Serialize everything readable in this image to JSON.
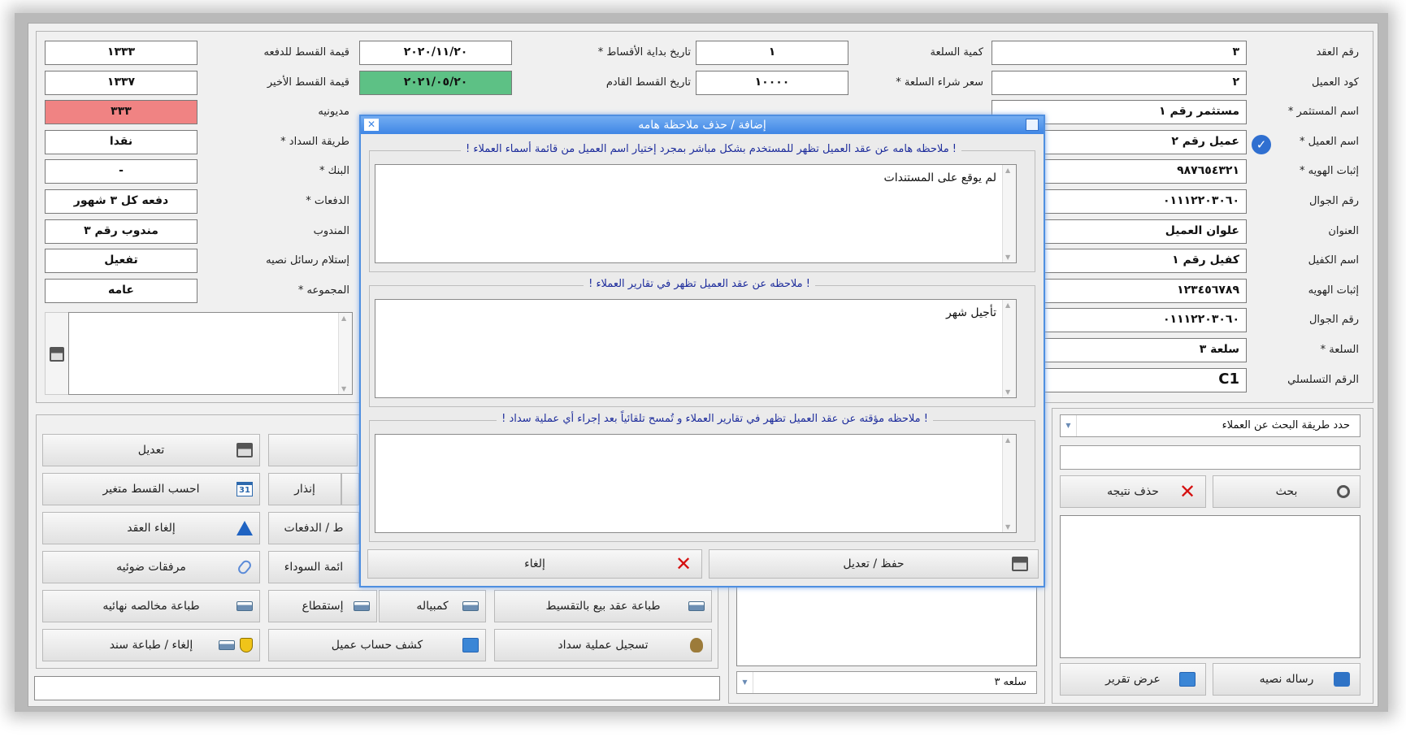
{
  "form": {
    "col1": {
      "labels": [
        "رقم العقد",
        "كود العميل",
        "* اسم المستثمر",
        "* اسم العميل",
        "* إثبات الهويه",
        "رقم الجوال",
        "العنوان",
        "اسم الكفيل",
        "إثبات الهويه",
        "رقم الجوال",
        "* السلعة",
        "الرقم التسلسلي"
      ],
      "values": [
        "٣",
        "٢",
        "مستثمر رقم ١",
        "عميل رقم ٢",
        "٩٨٧٦٥٤٣٢١",
        "٠١١١٢٢٠٣٠٦٠",
        "علوان العميل",
        "كفيل رقم ١",
        "١٢٣٤٥٦٧٨٩",
        "٠١١١٢٢٠٣٠٦٠",
        "سلعة ٣",
        "C1"
      ]
    },
    "col2": {
      "labels": [
        "كمية السلعة",
        "* سعر شراء السلعة"
      ],
      "values": [
        "١",
        "١٠٠٠٠"
      ]
    },
    "col3": {
      "labels": [
        "* تاريخ بداية الأقساط",
        "تاريخ القسط القادم"
      ],
      "values": [
        "٢٠٢٠/١١/٢٠",
        "٢٠٢١/٠٥/٢٠"
      ]
    },
    "col4": {
      "labels": [
        "قيمة القسط للدفعه",
        "قيمة القسط الأخير",
        "مديونيه",
        "* طريقة السداد",
        "* البنك",
        "* الدفعات",
        "المندوب",
        "إستلام رسائل نصيه",
        "* المجموعه"
      ],
      "values": [
        "١٣٣٣",
        "١٣٣٧",
        "٣٣٣",
        "نقدا",
        "-",
        "دفعه كل ٣ شهور",
        "مندوب رقم ٣",
        "تفعيل",
        "عامه"
      ]
    }
  },
  "buttons": {
    "edit": "تعديل",
    "variable_installment": "احسب القسط متغير",
    "warning": "إنذار",
    "cancel_contract": "إلغاء العقد",
    "payments": "ط / الدفعات",
    "attachments": "مرفقات ضوئيه",
    "blacklist": "ائمة السوداء",
    "print_clearance": "طباعة مخالصه نهائيه",
    "deduction": "إستقطاع",
    "promissory": "كمبياله",
    "print_contract": "طباعة عقد بيع بالتقسيط",
    "cancel_print_voucher": "إلغاء / طباعة سند",
    "account_statement": "كشف حساب عميل",
    "register_payment": "تسجيل عملية سداد",
    "search": "بحث",
    "delete_result": "حذف نتيجه",
    "text_message": "رساله نصيه",
    "show_report": "عرض تقرير"
  },
  "search_panel": {
    "method_placeholder": "حدد طريقة البحث عن العملاء",
    "item_combo": "سلعه ٣"
  },
  "modal": {
    "title": "إضافة / حذف ملاحظة هامه",
    "group1_legend": "! ملاحظه هامه عن عقد العميل تظهر للمستخدم بشكل مباشر بمجرد إختيار اسم العميل من قائمة أسماء العملاء !",
    "group1_text": "لم يوقع على المستندات",
    "group2_legend": "! ملاحظه عن عقد العميل تظهر في تقارير العملاء !",
    "group2_text": "تأجيل شهر",
    "group3_legend": "! ملاحظه مؤقته عن عقد العميل تظهر في تقارير العملاء و تُمسح تلقائياً بعد إجراء أي عملية سداد !",
    "group3_text": "",
    "save_label": "حفظ / تعديل",
    "cancel_label": "إلغاء"
  },
  "colors": {
    "accent": "#3f86e5",
    "green_field": "#5dc185",
    "red_field": "#f08383",
    "legend_text": "#1e2d9c"
  }
}
